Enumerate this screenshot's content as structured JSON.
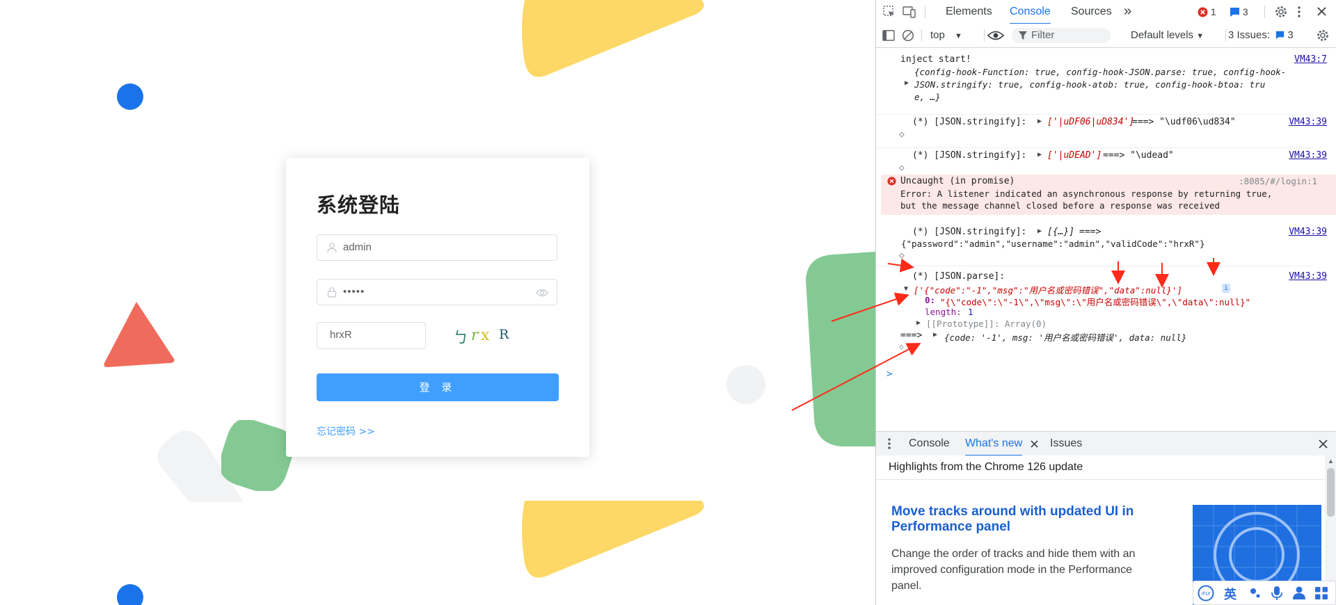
{
  "login": {
    "title": "系统登陆",
    "username_value": "admin",
    "password_value": "•••••",
    "captcha_value": "hrxR",
    "captcha_chars": [
      "ㄅ",
      "r",
      "x",
      "R"
    ],
    "login_button": "登 录",
    "forgot_link": "忘记密码 >>"
  },
  "devtools": {
    "tabs": [
      "Elements",
      "Console",
      "Sources",
      "»"
    ],
    "active_tab": "Console",
    "error_count": "1",
    "message_count": "3",
    "toolbar": {
      "context": "top",
      "filter_placeholder": "Filter",
      "levels": "Default levels",
      "issues_label": "3 Issues:",
      "issues_count": "3"
    },
    "console": {
      "m1_text": "inject start!",
      "m1_source": "VM43:7",
      "m1_obj_line1": "{config-hook-Function: true, config-hook-JSON.parse: true, config-hook-",
      "m1_obj_line2": "JSON.stringify: true, config-hook-atob: true, config-hook-btoa: tru",
      "m1_obj_line3": "e, …}",
      "m2_prefix": "(*) [JSON.stringify]:",
      "m2_arg": "['|uDF06|uD834']",
      "m2_result": "===> \"\\udf06\\ud834\"",
      "m2_source": "VM43:39",
      "m3_prefix": "(*) [JSON.stringify]:",
      "m3_arg": "['|uDEAD']",
      "m3_result": "===> \"\\udead\"",
      "m3_source": "VM43:39",
      "err_title": "Uncaught (in promise)",
      "err_source": ":8085/#/login:1",
      "err_line1": "Error: A listener indicated an asynchronous response by returning true,",
      "err_line2": "but the message channel closed before a response was received",
      "m4_prefix": "(*) [JSON.stringify]:",
      "m4_arg": "[{…}]",
      "m4_arrow": "===>",
      "m4_source": "VM43:39",
      "m4_result": "{\"password\":\"admin\",\"username\":\"admin\",\"validCode\":\"hrxR\"}",
      "m5_prefix": "(*) [JSON.parse]:",
      "m5_source": "VM43:39",
      "m5_array": "['{\"code\":\"-1\",\"msg\":\"用户名或密码错误\",\"data\":null}']",
      "m5_item_key": "0:",
      "m5_item_val": "\"{\\\"code\\\":\\\"-1\\\",\\\"msg\\\":\\\"用户名或密码错误\\\",\\\"data\\\":null}\"",
      "m5_length_key": "length:",
      "m5_length_val": "1",
      "m5_proto": "[[Prototype]]: Array(0)",
      "m5_arrow": "===>",
      "m5_obj": "{code: '-1', msg: '用户名或密码错误', data: null}",
      "prompt": ">"
    },
    "drawer": {
      "tabs": [
        "Console",
        "What's new",
        "Issues"
      ],
      "active_tab": "What's new",
      "heading": "Highlights from the Chrome 126 update",
      "feature_title": "Move tracks around with updated UI in Performance panel",
      "feature_desc": "Change the order of tracks and hide them with an improved configuration mode in the Performance panel."
    }
  },
  "ime": {
    "label": "英"
  },
  "colors": {
    "accent": "#409eff",
    "devtools_blue": "#1a73e8",
    "error_bg": "#fce8e6",
    "annotation_red": "#ff2a1a",
    "shape_yellow": "#fdd866",
    "shape_green": "#84c993",
    "shape_red": "#ef6b5b",
    "shape_blue": "#1a73e8"
  }
}
